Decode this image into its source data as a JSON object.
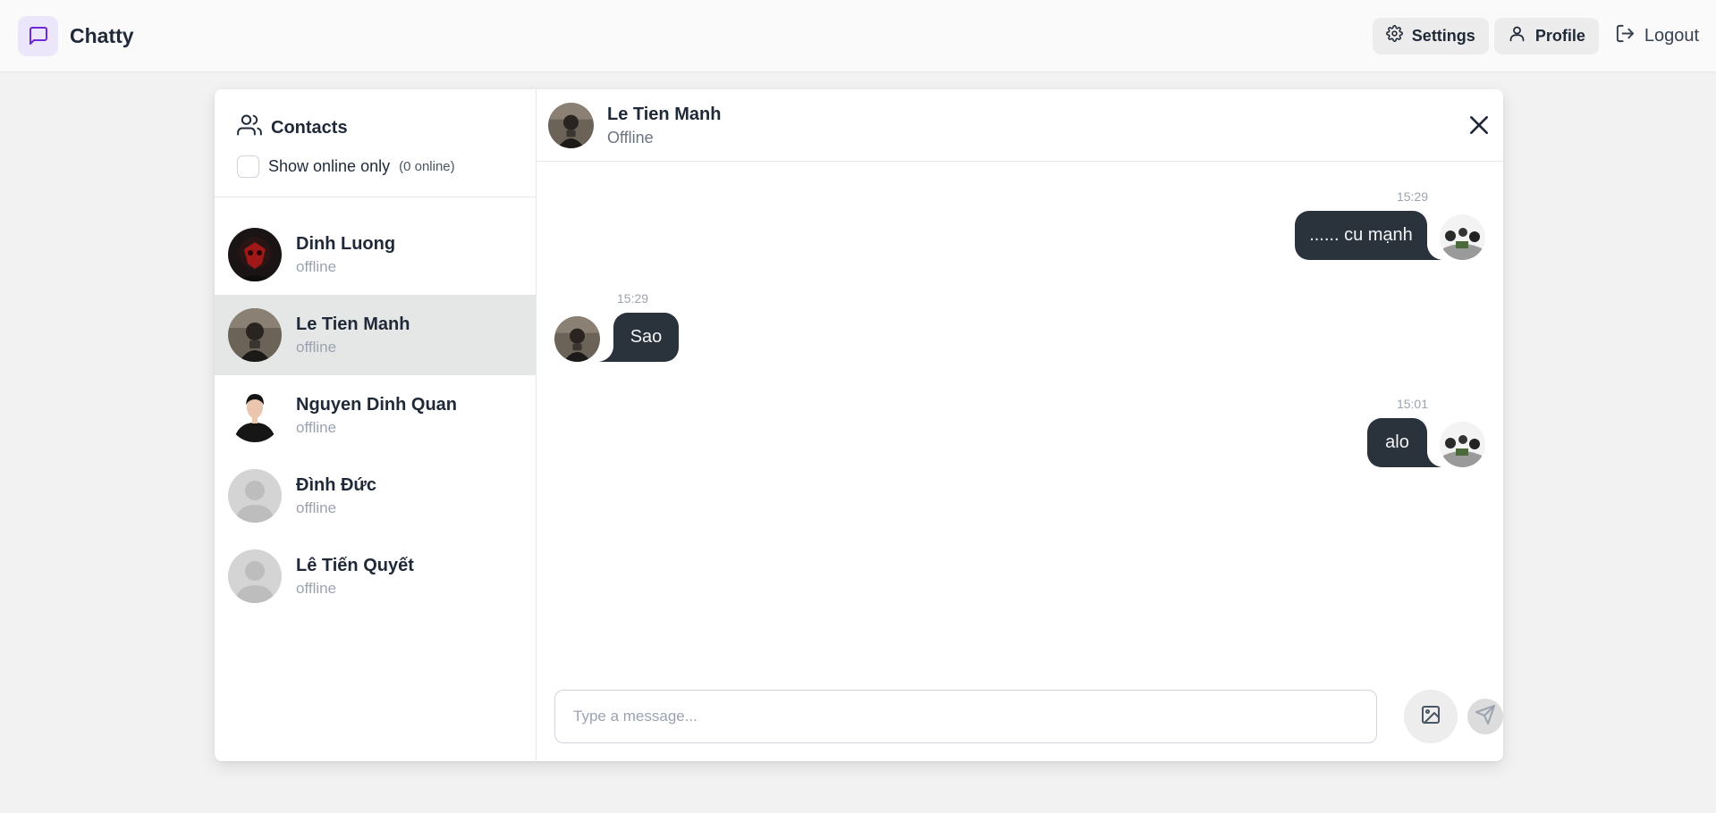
{
  "app": {
    "name": "Chatty",
    "logo_icon": "message-square-icon",
    "accent": "#6d28d9"
  },
  "nav": {
    "settings_label": "Settings",
    "profile_label": "Profile",
    "logout_label": "Logout"
  },
  "sidebar": {
    "title": "Contacts",
    "filter_label": "Show online only",
    "online_count": "(0 online)",
    "contacts": [
      {
        "name": "Dinh Luong",
        "status": "offline",
        "avatar": "photo-red-mask"
      },
      {
        "name": "Le Tien Manh",
        "status": "offline",
        "avatar": "photo-dark-scene",
        "active": true
      },
      {
        "name": "Nguyen Dinh Quan",
        "status": "offline",
        "avatar": "photo-portrait"
      },
      {
        "name": "Đình Đức",
        "status": "offline",
        "avatar": "default-avatar"
      },
      {
        "name": "Lê Tiến Quyết",
        "status": "offline",
        "avatar": "default-avatar"
      }
    ]
  },
  "chat": {
    "header": {
      "name": "Le Tien Manh",
      "status": "Offline"
    },
    "messages": [
      {
        "side": "right",
        "time": "15:29",
        "text": "...... cu mạnh"
      },
      {
        "side": "left",
        "time": "15:29",
        "text": "Sao"
      },
      {
        "side": "right",
        "time": "15:01",
        "text": "alo"
      }
    ],
    "input_placeholder": "Type a message...",
    "colors": {
      "bubble": "#2a323c",
      "bubble_text": "#f3f4f6"
    }
  }
}
